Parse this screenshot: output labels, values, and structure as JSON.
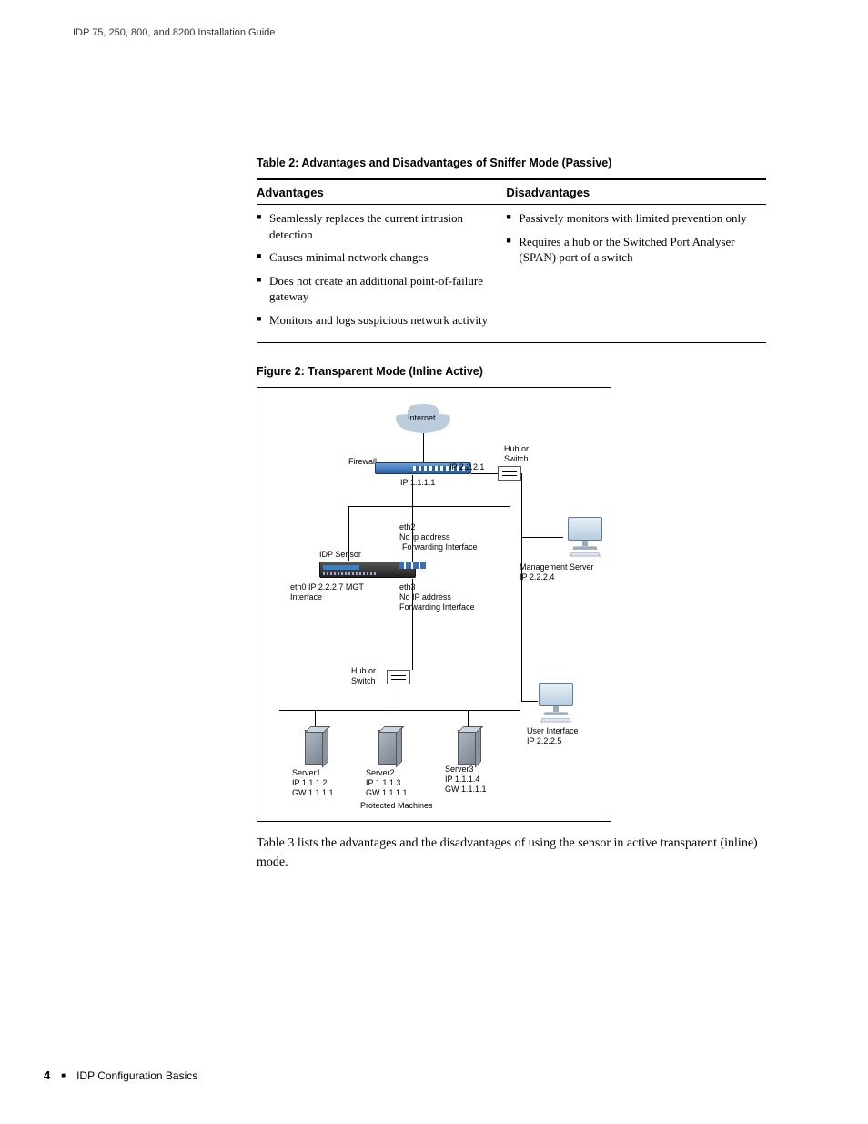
{
  "header": {
    "doc_title": "IDP 75, 250, 800, and 8200 Installation Guide"
  },
  "table2": {
    "caption": "Table 2:  Advantages and Disadvantages of Sniffer Mode (Passive)",
    "col1_header": "Advantages",
    "col2_header": "Disadvantages",
    "advantages": [
      "Seamlessly replaces the current intrusion detection",
      "Causes minimal network changes",
      "Does not create an additional point-of-failure gateway",
      "Monitors and logs suspicious network activity"
    ],
    "disadvantages": [
      "Passively monitors with limited prevention only",
      "Requires a hub or the Switched Port Analyser (SPAN) port of a switch"
    ]
  },
  "figure2": {
    "caption": "Figure 2:  Transparent Mode (Inline Active)",
    "labels": {
      "internet": "Internet",
      "firewall": "Firewall",
      "ip_2221": "IP 2.2.2.1",
      "ip_1111": "IP 1.1.1.1",
      "hub_switch_top": "Hub or\nSwitch",
      "eth2_line1": "eth2",
      "eth2_line2": "No ip address",
      "eth2_line3": "Forwarding Interface",
      "idp_sensor": "IDP Sensor",
      "eth0_line1": "eth0 IP 2.2.2.7 MGT",
      "eth0_line2": "Interface",
      "eth3_line1": "eth3",
      "eth3_line2": "No IP address",
      "eth3_line3": "Forwarding Interface",
      "mgmt_line1": "Management Server",
      "mgmt_line2": "IP 2.2.2.4",
      "hub_switch_bot": "Hub or\nSwitch",
      "ui_line1": "User Interface",
      "ui_line2": "IP 2.2.2.5",
      "server1_l1": "Server1",
      "server1_l2": "IP 1.1.1.2",
      "server1_l3": "GW 1.1.1.1",
      "server2_l1": "Server2",
      "server2_l2": "IP 1.1.1.3",
      "server2_l3": "GW 1.1.1.1",
      "server3_l1": "Server3",
      "server3_l2": "IP 1.1.1.4",
      "server3_l3": "GW 1.1.1.1",
      "protected": "Protected Machines"
    }
  },
  "body_para": "Table 3 lists the advantages and the disadvantages of using the sensor in active transparent (inline) mode.",
  "footer": {
    "page_number": "4",
    "section": "IDP Configuration Basics"
  },
  "chart_data": {
    "type": "network-diagram",
    "nodes": [
      {
        "id": "internet",
        "label": "Internet",
        "kind": "cloud"
      },
      {
        "id": "firewall",
        "label": "Firewall",
        "kind": "firewall",
        "ips": {
          "wan": "2.2.2.1",
          "lan": "1.1.1.1"
        }
      },
      {
        "id": "switch_top",
        "label": "Hub or Switch",
        "kind": "switch"
      },
      {
        "id": "idp",
        "label": "IDP Sensor",
        "kind": "sensor",
        "interfaces": [
          {
            "name": "eth0",
            "ip": "2.2.2.7",
            "role": "MGT Interface"
          },
          {
            "name": "eth2",
            "ip": null,
            "role": "Forwarding Interface"
          },
          {
            "name": "eth3",
            "ip": null,
            "role": "Forwarding Interface"
          }
        ]
      },
      {
        "id": "mgmt",
        "label": "Management Server",
        "kind": "host",
        "ip": "2.2.2.4"
      },
      {
        "id": "ui",
        "label": "User Interface",
        "kind": "host",
        "ip": "2.2.2.5"
      },
      {
        "id": "switch_bot",
        "label": "Hub or Switch",
        "kind": "switch"
      },
      {
        "id": "server1",
        "label": "Server1",
        "kind": "server",
        "ip": "1.1.1.2",
        "gw": "1.1.1.1"
      },
      {
        "id": "server2",
        "label": "Server2",
        "kind": "server",
        "ip": "1.1.1.3",
        "gw": "1.1.1.1"
      },
      {
        "id": "server3",
        "label": "Server3",
        "kind": "server",
        "ip": "1.1.1.4",
        "gw": "1.1.1.1"
      }
    ],
    "edges": [
      [
        "internet",
        "firewall"
      ],
      [
        "firewall",
        "idp.eth2"
      ],
      [
        "firewall",
        "switch_top"
      ],
      [
        "switch_top",
        "mgmt"
      ],
      [
        "switch_top",
        "ui"
      ],
      [
        "switch_top",
        "idp.eth0"
      ],
      [
        "idp.eth3",
        "switch_bot"
      ],
      [
        "switch_bot",
        "server1"
      ],
      [
        "switch_bot",
        "server2"
      ],
      [
        "switch_bot",
        "server3"
      ]
    ],
    "group": {
      "label": "Protected Machines",
      "members": [
        "server1",
        "server2",
        "server3"
      ]
    }
  }
}
